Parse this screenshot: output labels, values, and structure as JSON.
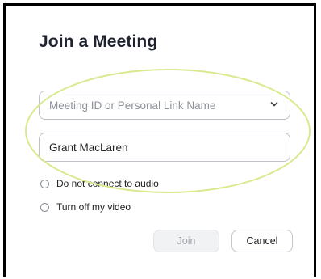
{
  "dialog": {
    "title": "Join a Meeting",
    "meeting_field": {
      "placeholder": "Meeting ID or Personal Link Name"
    },
    "name_field": {
      "value": "Grant MacLaren"
    },
    "options": [
      {
        "label": "Do not connect to audio",
        "checked": false
      },
      {
        "label": "Turn off my video",
        "checked": false
      }
    ],
    "buttons": {
      "join_label": "Join",
      "cancel_label": "Cancel"
    }
  },
  "colors": {
    "highlight_ellipse": "#d8ea8f",
    "frame_border": "#000000",
    "title_text": "#1f2330"
  },
  "icons": {
    "dropdown": "chevron-down-icon"
  }
}
